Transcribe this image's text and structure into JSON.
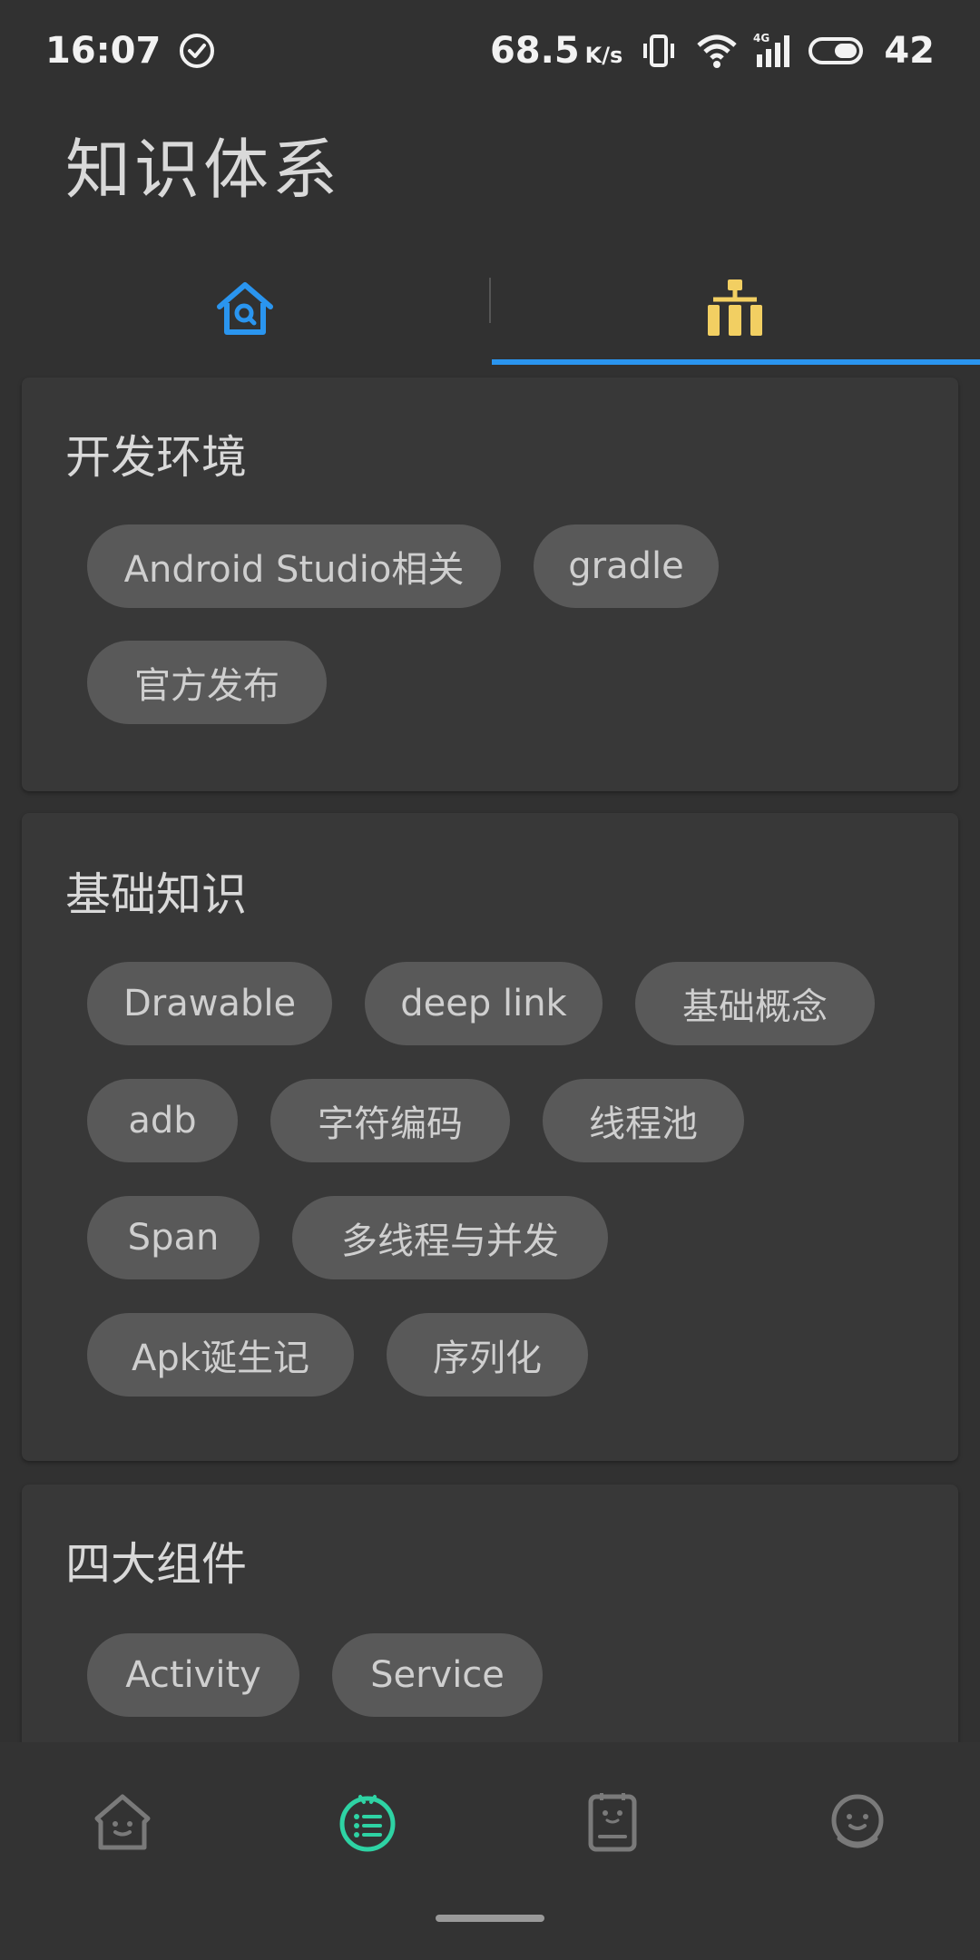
{
  "status_bar": {
    "time": "16:07",
    "network_speed": "68.5",
    "network_speed_unit": "K/s",
    "battery_level": "42"
  },
  "header": {
    "title": "知识体系"
  },
  "tabs": {
    "active_index": 1,
    "accent_color": "#2a95ef",
    "items": [
      {
        "icon": "house-search-icon",
        "color": "#2a95ef"
      },
      {
        "icon": "hierarchy-icon",
        "color": "#f2cf62"
      }
    ]
  },
  "categories": [
    {
      "title": "开发环境",
      "tags": [
        "Android Studio相关",
        "gradle",
        "官方发布"
      ]
    },
    {
      "title": "基础知识",
      "tags": [
        "Drawable",
        "deep link",
        "基础概念",
        "adb",
        "字符编码",
        "线程池",
        "Span",
        "多线程与并发",
        "Apk诞生记",
        "序列化"
      ]
    },
    {
      "title": "四大组件",
      "tags": [
        "Activity",
        "Service"
      ]
    }
  ],
  "bottom_nav": {
    "active_index": 1,
    "active_color": "#2ed3a4",
    "items": [
      {
        "icon": "home-face-icon"
      },
      {
        "icon": "list-face-icon"
      },
      {
        "icon": "notebook-face-icon"
      },
      {
        "icon": "profile-face-icon"
      }
    ]
  }
}
